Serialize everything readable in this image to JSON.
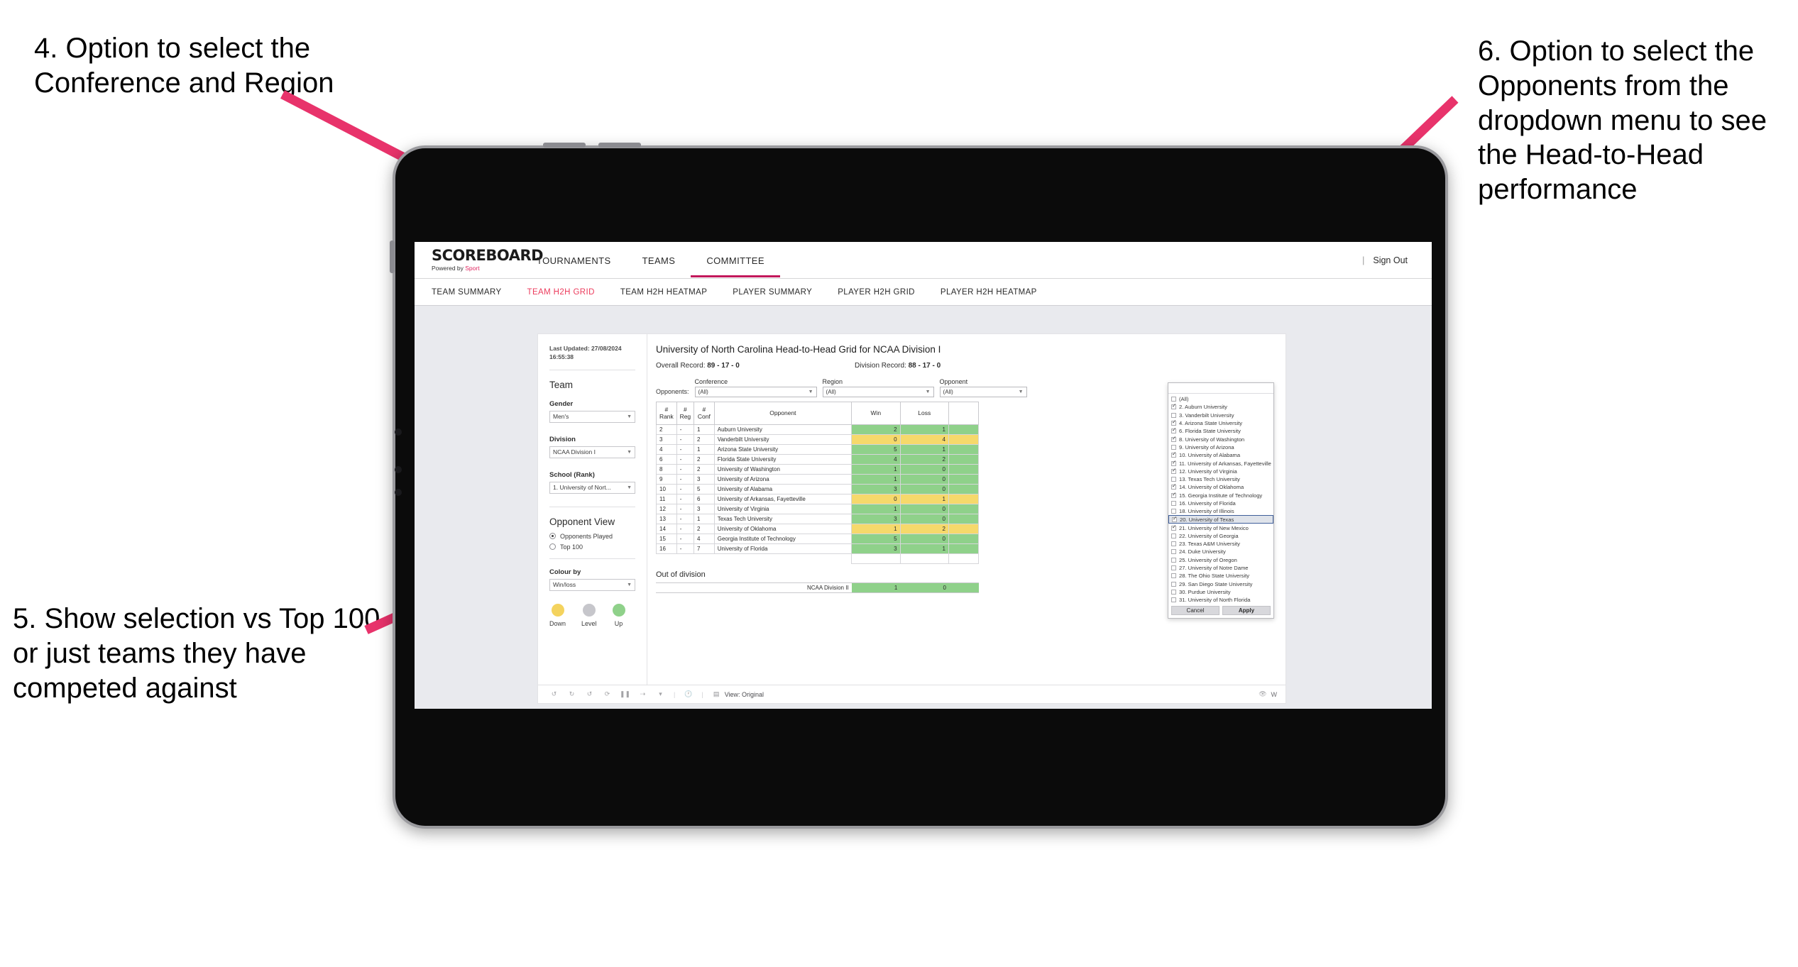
{
  "annotations": [
    {
      "id": "a4",
      "text": "4. Option to select the Conference and Region"
    },
    {
      "id": "a5",
      "text": "5. Show selection vs Top 100 or just teams they have competed against"
    },
    {
      "id": "a6",
      "text": "6. Option to select the Opponents from the dropdown menu to see the Head-to-Head performance"
    }
  ],
  "app": {
    "logo": {
      "title": "SCOREBOARD",
      "sub_prefix": "Powered by ",
      "sub_brand": "Sport"
    },
    "topnav": [
      {
        "label": "TOURNAMENTS",
        "active": false
      },
      {
        "label": "TEAMS",
        "active": false
      },
      {
        "label": "COMMITTEE",
        "active": true
      }
    ],
    "topnav_right": {
      "divider": "|",
      "sign_out": "Sign Out"
    },
    "subnav": [
      {
        "label": "TEAM SUMMARY",
        "active": false
      },
      {
        "label": "TEAM H2H GRID",
        "active": true
      },
      {
        "label": "TEAM H2H HEATMAP",
        "active": false
      },
      {
        "label": "PLAYER SUMMARY",
        "active": false
      },
      {
        "label": "PLAYER H2H GRID",
        "active": false
      },
      {
        "label": "PLAYER H2H HEATMAP",
        "active": false
      }
    ]
  },
  "filters": {
    "last_updated": "Last Updated: 27/08/2024\n16:55:38",
    "team_heading": "Team",
    "gender": {
      "label": "Gender",
      "value": "Men's"
    },
    "division": {
      "label": "Division",
      "value": "NCAA Division I"
    },
    "school": {
      "label": "School (Rank)",
      "value": "1. University of Nort..."
    },
    "opponent_view": {
      "heading": "Opponent View",
      "options": [
        {
          "label": "Opponents Played",
          "selected": true
        },
        {
          "label": "Top 100",
          "selected": false
        }
      ]
    },
    "colour_by": {
      "label": "Colour by",
      "value": "Win/loss"
    },
    "legend": [
      {
        "label": "Down",
        "color": "#f4d35e"
      },
      {
        "label": "Level",
        "color": "#c6c6cb"
      },
      {
        "label": "Up",
        "color": "#8fd18a"
      }
    ]
  },
  "report": {
    "title": "University of North Carolina Head-to-Head Grid for NCAA Division I",
    "overall_record_label": "Overall Record:",
    "overall_record_value": "89 - 17 - 0",
    "division_record_label": "Division Record:",
    "division_record_value": "88 - 17 - 0",
    "opponents_label": "Opponents:",
    "conference": {
      "label": "Conference",
      "value": "(All)"
    },
    "region": {
      "label": "Region",
      "value": "(All)"
    },
    "opponent": {
      "label": "Opponent",
      "value": "(All)"
    },
    "columns": [
      "# Rank",
      "# Reg",
      "# Conf",
      "Opponent",
      "Win",
      "Loss"
    ],
    "rows": [
      {
        "rank": "2",
        "reg": "-",
        "conf": "1",
        "opponent": "Auburn University",
        "win": "2",
        "loss": "1",
        "state": "up"
      },
      {
        "rank": "3",
        "reg": "-",
        "conf": "2",
        "opponent": "Vanderbilt University",
        "win": "0",
        "loss": "4",
        "state": "down"
      },
      {
        "rank": "4",
        "reg": "-",
        "conf": "1",
        "opponent": "Arizona State University",
        "win": "5",
        "loss": "1",
        "state": "up"
      },
      {
        "rank": "6",
        "reg": "-",
        "conf": "2",
        "opponent": "Florida State University",
        "win": "4",
        "loss": "2",
        "state": "up"
      },
      {
        "rank": "8",
        "reg": "-",
        "conf": "2",
        "opponent": "University of Washington",
        "win": "1",
        "loss": "0",
        "state": "up"
      },
      {
        "rank": "9",
        "reg": "-",
        "conf": "3",
        "opponent": "University of Arizona",
        "win": "1",
        "loss": "0",
        "state": "up"
      },
      {
        "rank": "10",
        "reg": "-",
        "conf": "5",
        "opponent": "University of Alabama",
        "win": "3",
        "loss": "0",
        "state": "up"
      },
      {
        "rank": "11",
        "reg": "-",
        "conf": "6",
        "opponent": "University of Arkansas, Fayetteville",
        "win": "0",
        "loss": "1",
        "state": "down"
      },
      {
        "rank": "12",
        "reg": "-",
        "conf": "3",
        "opponent": "University of Virginia",
        "win": "1",
        "loss": "0",
        "state": "up"
      },
      {
        "rank": "13",
        "reg": "-",
        "conf": "1",
        "opponent": "Texas Tech University",
        "win": "3",
        "loss": "0",
        "state": "up"
      },
      {
        "rank": "14",
        "reg": "-",
        "conf": "2",
        "opponent": "University of Oklahoma",
        "win": "1",
        "loss": "2",
        "state": "down"
      },
      {
        "rank": "15",
        "reg": "-",
        "conf": "4",
        "opponent": "Georgia Institute of Technology",
        "win": "5",
        "loss": "0",
        "state": "up"
      },
      {
        "rank": "16",
        "reg": "-",
        "conf": "7",
        "opponent": "University of Florida",
        "win": "3",
        "loss": "1",
        "state": "up"
      }
    ],
    "out_of_division": {
      "title": "Out of division",
      "rows": [
        {
          "name": "NCAA Division II",
          "win": "1",
          "loss": "0",
          "state": "up"
        }
      ]
    }
  },
  "opponent_dropdown": {
    "search_value": "",
    "actions": {
      "cancel": "Cancel",
      "apply": "Apply"
    },
    "items": [
      {
        "label": "(All)",
        "checked": false,
        "highlight": false
      },
      {
        "label": "2. Auburn University",
        "checked": true,
        "highlight": false
      },
      {
        "label": "3. Vanderbilt University",
        "checked": false,
        "highlight": false
      },
      {
        "label": "4. Arizona State University",
        "checked": true,
        "highlight": false
      },
      {
        "label": "6. Florida State University",
        "checked": true,
        "highlight": false
      },
      {
        "label": "8. University of Washington",
        "checked": true,
        "highlight": false
      },
      {
        "label": "9. University of Arizona",
        "checked": false,
        "highlight": false
      },
      {
        "label": "10. University of Alabama",
        "checked": true,
        "highlight": false
      },
      {
        "label": "11. University of Arkansas, Fayetteville",
        "checked": true,
        "highlight": false
      },
      {
        "label": "12. University of Virginia",
        "checked": true,
        "highlight": false
      },
      {
        "label": "13. Texas Tech University",
        "checked": false,
        "highlight": false
      },
      {
        "label": "14. University of Oklahoma",
        "checked": true,
        "highlight": false
      },
      {
        "label": "15. Georgia Institute of Technology",
        "checked": true,
        "highlight": false
      },
      {
        "label": "16. University of Florida",
        "checked": false,
        "highlight": false
      },
      {
        "label": "18. University of Illinois",
        "checked": false,
        "highlight": false
      },
      {
        "label": "20. University of Texas",
        "checked": true,
        "highlight": true
      },
      {
        "label": "21. University of New Mexico",
        "checked": true,
        "highlight": false
      },
      {
        "label": "22. University of Georgia",
        "checked": false,
        "highlight": false
      },
      {
        "label": "23. Texas A&M University",
        "checked": false,
        "highlight": false
      },
      {
        "label": "24. Duke University",
        "checked": false,
        "highlight": false
      },
      {
        "label": "25. University of Oregon",
        "checked": false,
        "highlight": false
      },
      {
        "label": "27. University of Notre Dame",
        "checked": false,
        "highlight": false
      },
      {
        "label": "28. The Ohio State University",
        "checked": false,
        "highlight": false
      },
      {
        "label": "29. San Diego State University",
        "checked": false,
        "highlight": false
      },
      {
        "label": "30. Purdue University",
        "checked": false,
        "highlight": false
      },
      {
        "label": "31. University of North Florida",
        "checked": false,
        "highlight": false
      }
    ]
  },
  "toolbar": {
    "icons": [
      "undo-icon",
      "redo-icon",
      "revert-icon",
      "refresh-data-icon",
      "pause-icon",
      "share-icon",
      "chevron-down-icon"
    ],
    "clock_icon": "clock-icon",
    "view_label": "View: Original",
    "watch_label": "W"
  },
  "theme": {
    "accent": "#ec3b5c",
    "arrow": "#e8336b",
    "up": "#8fd18a",
    "down": "#f4d35e",
    "level": "#c6c6cb"
  }
}
